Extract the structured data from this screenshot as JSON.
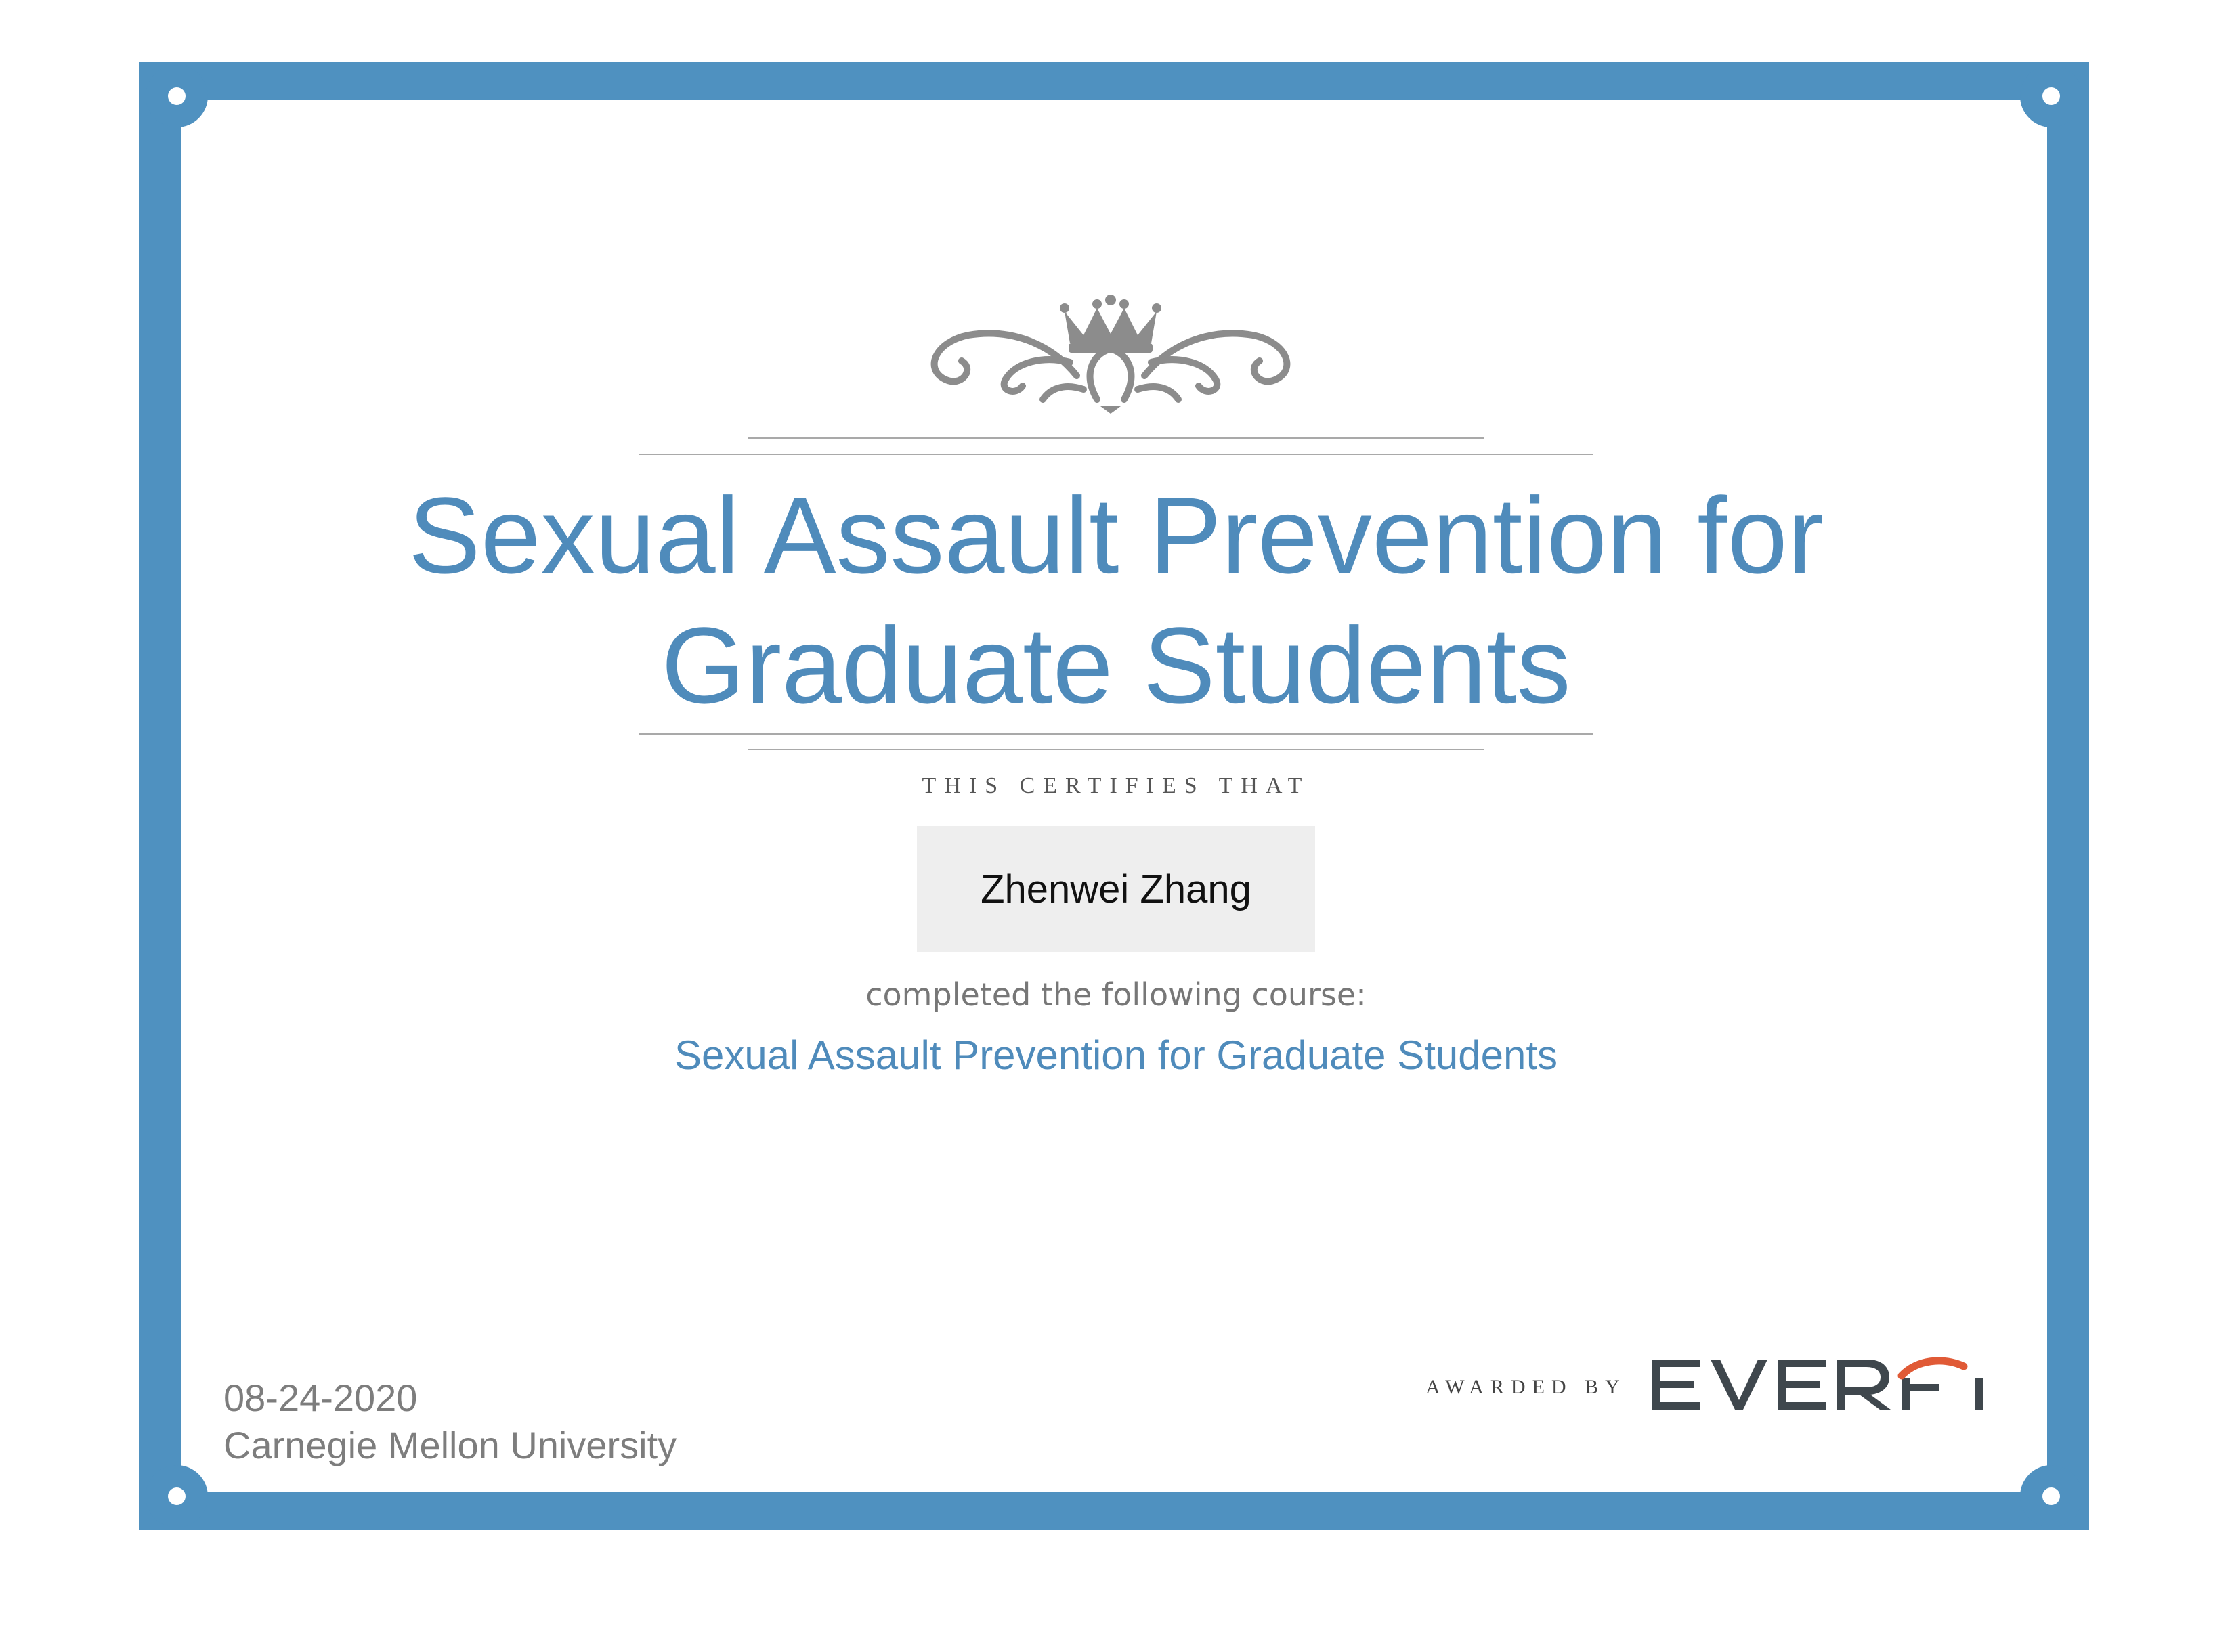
{
  "certificate": {
    "title": "Sexual Assault Prevention for Graduate Students",
    "certifies_text": "THIS CERTIFIES THAT",
    "recipient_name": "Zhenwei Zhang",
    "completed_text": "completed the following course:",
    "course_name": "Sexual Assault Prevention for Graduate Students",
    "date": "08-24-2020",
    "organization": "Carnegie Mellon University",
    "awarded_by_text": "AWARDED BY",
    "brand_logo_text": "EVERFI"
  },
  "colors": {
    "frame_blue": "#4f91c0",
    "title_blue": "#4f8bbb",
    "brand_dark": "#3f474d",
    "brand_accent": "#e05a36",
    "ornament_gray": "#8c8c8c"
  },
  "icons": {
    "crest": "crown-scroll-ornament-icon",
    "brand": "everfi-logo"
  }
}
